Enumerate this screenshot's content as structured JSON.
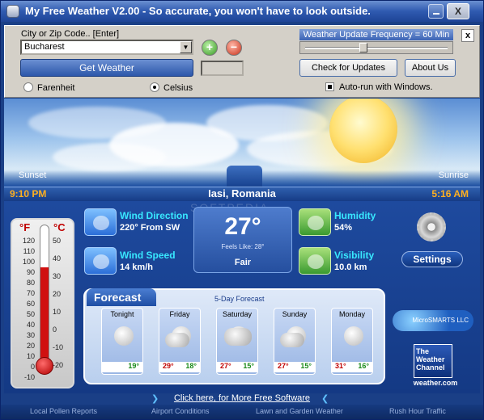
{
  "window": {
    "title": "My Free Weather V2.00  -  So accurate, you won't have to look outside.",
    "close_label": "X"
  },
  "controls": {
    "city_label": "City or Zip Code..  [Enter]",
    "city_value": "Bucharest",
    "add_label": "+",
    "remove_label": "−",
    "get_weather_label": "Get Weather",
    "units": [
      "Farenheit",
      "Celsius"
    ],
    "selected_unit": "Celsius",
    "update_frequency_label": "Weather Update Frequency = 60 Min",
    "update_frequency_minutes": 60,
    "panel_close_label": "x",
    "check_updates_label": "Check for Updates",
    "about_label": "About Us",
    "autorun_label": "Auto-run with Windows.",
    "autorun_checked": true
  },
  "sky": {
    "sunset_label": "Sunset",
    "sunrise_label": "Sunrise"
  },
  "info": {
    "sunset_time": "9:10 PM",
    "location": "Iasi, Romania",
    "sunrise_time": "5:16 AM"
  },
  "current": {
    "temperature": "27°",
    "feels_like": "Feels Like: 28°",
    "condition": "Fair",
    "wind_direction_title": "Wind Direction",
    "wind_direction_value": "220° From SW",
    "wind_speed_title": "Wind Speed",
    "wind_speed_value": "14 km/h",
    "humidity_title": "Humidity",
    "humidity_value": "54%",
    "visibility_title": "Visibility",
    "visibility_value": "10.0 km",
    "settings_label": "Settings"
  },
  "thermometer": {
    "f_label": "°F",
    "c_label": "°C",
    "f_scale": [
      "120",
      "110",
      "100",
      "90",
      "80",
      "70",
      "60",
      "50",
      "40",
      "30",
      "20",
      "10",
      "0",
      "-10"
    ],
    "c_scale": [
      "50",
      "40",
      "30",
      "20",
      "10",
      "0",
      "-10",
      "-20"
    ],
    "reading_celsius": 27,
    "range_celsius": [
      -25,
      50
    ]
  },
  "forecast": {
    "title": "Forecast",
    "subtitle": "5-Day Forecast",
    "days": [
      {
        "name": "Tonight",
        "high": "",
        "low": "19°",
        "icon": "sun-icon"
      },
      {
        "name": "Friday",
        "high": "29°",
        "low": "18°",
        "icon": "partly-cloudy-icon"
      },
      {
        "name": "Saturday",
        "high": "27°",
        "low": "15°",
        "icon": "thunderstorm-icon"
      },
      {
        "name": "Sunday",
        "high": "27°",
        "low": "15°",
        "icon": "partly-cloudy-icon"
      },
      {
        "name": "Monday",
        "high": "31°",
        "low": "16°",
        "icon": "sun-icon"
      }
    ]
  },
  "branding": {
    "microsmarts": "MicroSMARTS LLC",
    "twc_line1": "The",
    "twc_line2": "Weather",
    "twc_line3": "Channel",
    "weathercom": "weather.com",
    "watermark": "SOFTPEDIA"
  },
  "promo": {
    "link_text": "Click here, for More Free Software"
  },
  "footer": {
    "links": [
      "Local Pollen Reports",
      "Airport Conditions",
      "Lawn and Garden Weather",
      "Rush Hour Traffic"
    ]
  },
  "colors": {
    "accent_cyan": "#38e8ff",
    "time_orange": "#ffb020",
    "hi_red": "#c00000",
    "lo_green": "#1a8a1a"
  }
}
